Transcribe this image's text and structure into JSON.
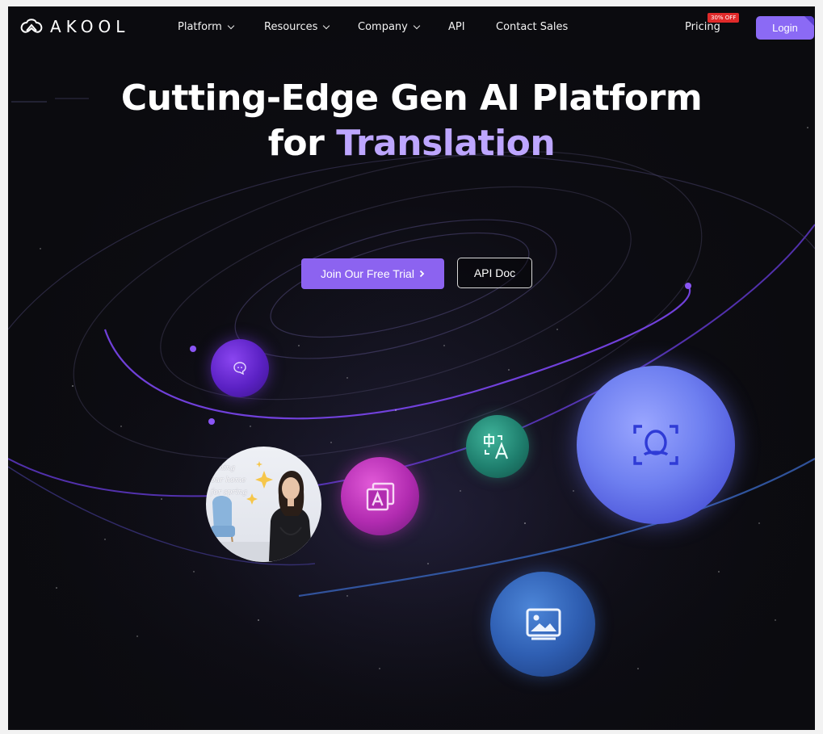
{
  "brand": {
    "name": "AKOOL",
    "accent_color": "#8b6af5"
  },
  "nav": {
    "items": [
      {
        "label": "Platform",
        "has_dropdown": true
      },
      {
        "label": "Resources",
        "has_dropdown": true
      },
      {
        "label": "Company",
        "has_dropdown": true
      },
      {
        "label": "API",
        "has_dropdown": false
      },
      {
        "label": "Contact Sales",
        "has_dropdown": false
      }
    ],
    "pricing_label": "Pricing",
    "pricing_badge": "30% OFF",
    "login_label": "Login"
  },
  "hero": {
    "headline_line1": "Cutting-Edge Gen AI Platform",
    "headline_line2_prefix": "for",
    "headline_line2_accent": "Translation",
    "accent_color": "#bda6ff",
    "primary_cta": "Join Our Free Trial",
    "secondary_cta": "API Doc"
  },
  "feature_bubbles": [
    {
      "icon": "chat-bubble-icon",
      "color": "#6a2ed8"
    },
    {
      "icon": "avatar-video-preview",
      "caption_lines": [
        "eshing",
        "our home",
        "for spring"
      ]
    },
    {
      "icon": "text-a-icon",
      "color": "#c03cbf"
    },
    {
      "icon": "translate-icon",
      "color": "#249077"
    },
    {
      "icon": "face-scan-icon",
      "color": "#6e7ff0"
    },
    {
      "icon": "image-icon",
      "color": "#2f5fb3"
    }
  ]
}
